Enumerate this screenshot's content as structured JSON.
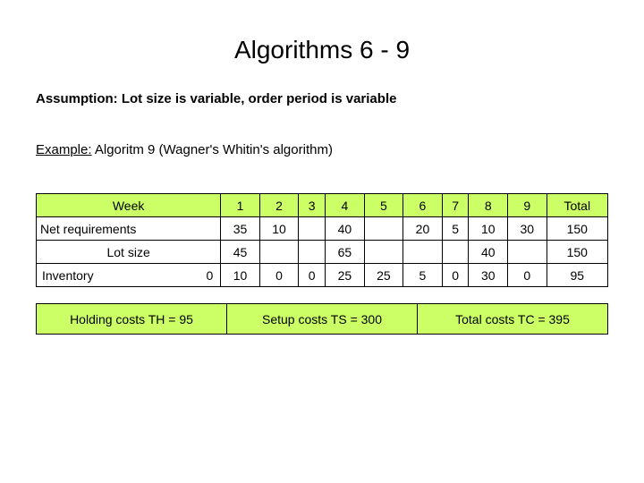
{
  "title": "Algorithms 6 - 9",
  "assumption": "Assumption: Lot size is variable,  order period is variable",
  "example_label": "Example:",
  "example_text": " Algoritm 9 (Wagner's Whitin's algorithm)",
  "table": {
    "header": {
      "label": "Week",
      "cols": [
        "1",
        "2",
        "3",
        "4",
        "5",
        "6",
        "7",
        "8",
        "9",
        "Total"
      ]
    },
    "rows": [
      {
        "label": "Net requirements",
        "cells": [
          "35",
          "10",
          "",
          "40",
          "",
          "20",
          "5",
          "10",
          "30",
          "150"
        ]
      },
      {
        "label": "Lot size",
        "cells": [
          "45",
          "",
          "",
          "65",
          "",
          "",
          "",
          "40",
          "",
          "150"
        ]
      },
      {
        "label": "Inventory",
        "initial": "0",
        "cells": [
          "10",
          "0",
          "0",
          "25",
          "25",
          "5",
          "0",
          "30",
          "0",
          "95"
        ]
      }
    ]
  },
  "costs": {
    "holding": "Holding costs TH = 95",
    "setup": "Setup costs  TS = 300",
    "total": "Total costs  TC = 395"
  },
  "chart_data": {
    "type": "table",
    "title": "Algorithms 6 - 9 — Wagner-Whitin example",
    "columns": [
      "Week",
      "1",
      "2",
      "3",
      "4",
      "5",
      "6",
      "7",
      "8",
      "9",
      "Total"
    ],
    "rows": [
      [
        "Net requirements",
        35,
        10,
        null,
        40,
        null,
        20,
        5,
        10,
        30,
        150
      ],
      [
        "Lot size",
        45,
        null,
        null,
        65,
        null,
        null,
        null,
        40,
        null,
        150
      ],
      [
        "Inventory (start 0)",
        10,
        0,
        0,
        25,
        25,
        5,
        0,
        30,
        0,
        95
      ]
    ],
    "summary": {
      "holding_cost_TH": 95,
      "setup_cost_TS": 300,
      "total_cost_TC": 395
    }
  }
}
